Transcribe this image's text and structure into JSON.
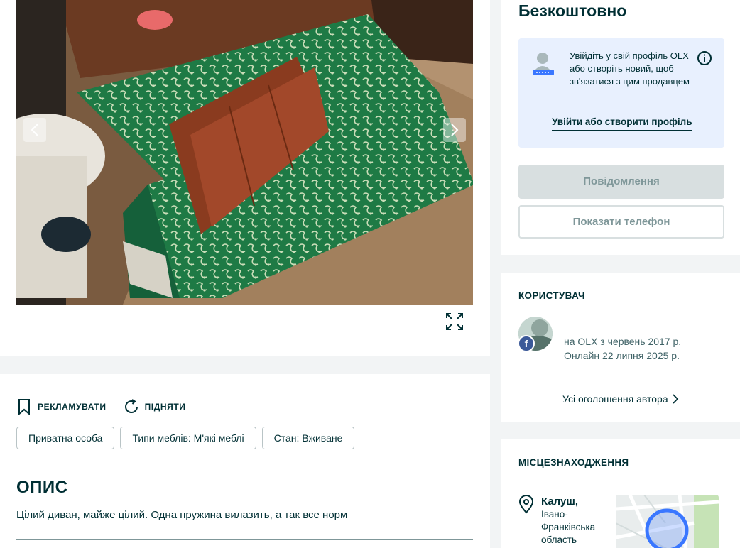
{
  "gallery": {
    "prev_icon": "chevron-left-icon",
    "next_icon": "chevron-right-icon",
    "expand_icon": "expand-icon"
  },
  "actions": {
    "promote_label": "РЕКЛАМУВАТИ",
    "raise_label": "ПІДНЯТИ"
  },
  "tags": [
    "Приватна особа",
    "Типи меблів: М'які меблі",
    "Стан: Вживане"
  ],
  "description": {
    "title": "ОПИС",
    "text": "Цілий диван, майже цілий. Одна пружина вилазить, а так все норм"
  },
  "price": {
    "value": "Безкоштовно"
  },
  "login": {
    "text": "Увійдіть у свій профіль OLX або створіть новий, щоб зв'язатися з цим продавцем",
    "link": "Увійти або створити профіль"
  },
  "buttons": {
    "message": "Повідомлення",
    "phone": "Показати телефон"
  },
  "user": {
    "section_title": "КОРИСТУВАЧ",
    "since": "на OLX з червень 2017 р.",
    "online": "Онлайн 22 липня 2025 р.",
    "all_ads": "Усі оголошення автора",
    "badge": "f"
  },
  "location": {
    "section_title": "МІСЦЕЗНАХОДЖЕННЯ",
    "city": "Калуш,",
    "region": "Івано-Франківська область"
  },
  "colors": {
    "primary_text": "#002f34",
    "muted_text": "#406367",
    "disabled_button": "#d8dfe0",
    "login_box_bg": "#e8f0fe",
    "page_bg": "#f2f4f5",
    "facebook": "#3b5998"
  }
}
